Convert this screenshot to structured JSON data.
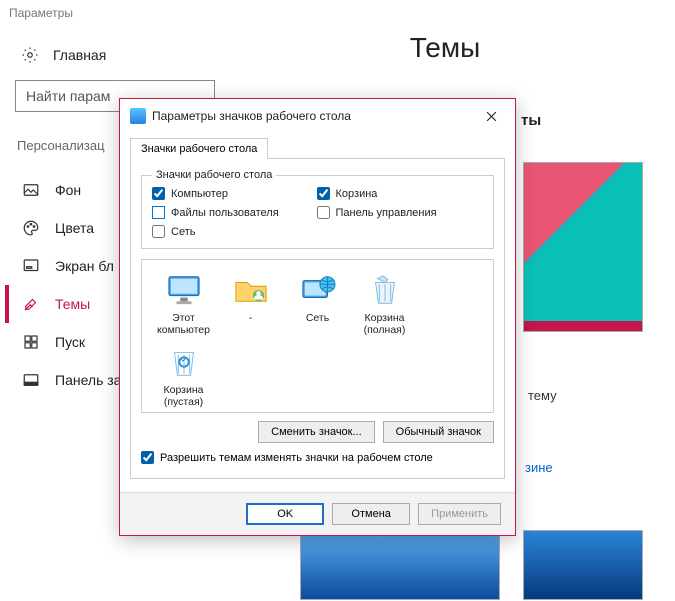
{
  "app": {
    "title": "Параметры"
  },
  "sidebar": {
    "home_label": "Главная",
    "search_placeholder": "Найти парам",
    "section": "Персонализац",
    "items": [
      {
        "label": "Фон"
      },
      {
        "label": "Цвета"
      },
      {
        "label": "Экран бл"
      },
      {
        "label": "Темы"
      },
      {
        "label": "Пуск"
      },
      {
        "label": "Панель за"
      }
    ]
  },
  "page": {
    "title": "Темы",
    "preview_hint": "ты",
    "use_theme_fragment": "тему",
    "store_link_fragment": "зине"
  },
  "dialog": {
    "title": "Параметры значков рабочего стола",
    "tab_label": "Значки рабочего стола",
    "group_legend": "Значки рабочего стола",
    "checkboxes": {
      "computer": {
        "label": "Компьютер",
        "checked": true,
        "style": "check"
      },
      "recyclebin": {
        "label": "Корзина",
        "checked": true,
        "style": "check"
      },
      "userfiles": {
        "label": "Файлы пользователя",
        "checked": false,
        "style": "blue"
      },
      "controlpanel": {
        "label": "Панель управления",
        "checked": false,
        "style": "plain"
      },
      "network": {
        "label": "Сеть",
        "checked": false,
        "style": "plain"
      }
    },
    "icons": [
      {
        "id": "this-pc",
        "label": "Этот\nкомпьютер"
      },
      {
        "id": "user-folder",
        "label": "-"
      },
      {
        "id": "network",
        "label": "Сеть"
      },
      {
        "id": "bin-full",
        "label": "Корзина\n(полная)"
      },
      {
        "id": "spacer",
        "label": ""
      },
      {
        "id": "bin-empty",
        "label": "Корзина\n(пустая)"
      }
    ],
    "buttons": {
      "change_icon": "Сменить значок...",
      "restore": "Обычный значок"
    },
    "allow_themes": {
      "label": "Разрешить темам изменять значки на рабочем столе",
      "checked": true
    },
    "footer": {
      "ok": "OK",
      "cancel": "Отмена",
      "apply": "Применить"
    }
  }
}
